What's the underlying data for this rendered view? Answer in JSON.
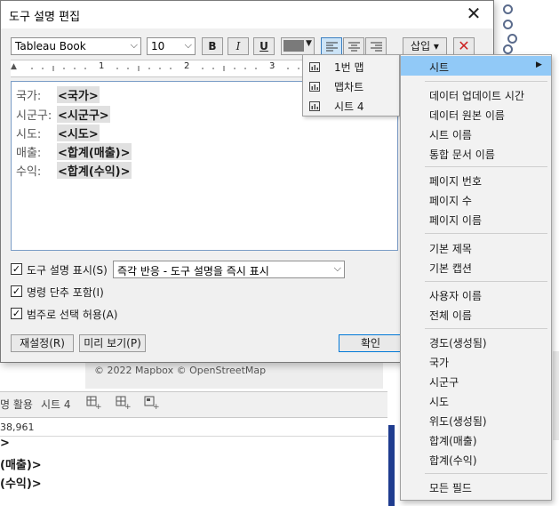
{
  "dialog": {
    "title": "도구 설명 편집",
    "font_name": "Tableau Book",
    "font_size": "10",
    "bold_label": "B",
    "italic_label": "I",
    "underline_label": "U",
    "insert_label": "삽입 ▾",
    "ruler_numbers": [
      "1",
      "2",
      "3"
    ],
    "lines": [
      {
        "label": "국가:",
        "field": "<국가>"
      },
      {
        "label": "시군구:",
        "field": "<시군구>"
      },
      {
        "label": "시도:",
        "field": "<시도>"
      },
      {
        "label": "매출:",
        "field": "<합계(매출)>"
      },
      {
        "label": "수익:",
        "field": "<합계(수익)>"
      }
    ],
    "options": {
      "show_tooltip": {
        "label": "도구 설명 표시(S)",
        "checked": true
      },
      "tooltip_mode": "즉각 반응 - 도구 설명을 즉시 표시",
      "include_brief": {
        "label": "명령 단추 포함(I)",
        "checked": true
      },
      "allow_category": {
        "label": "범주로 선택 허용(A)",
        "checked": true
      }
    },
    "buttons": {
      "reset": "재설정(R)",
      "preview": "미리 보기(P)",
      "ok": "확인"
    }
  },
  "sheet_menu": {
    "items": [
      "1번 맵",
      "맵차트",
      "시트 4"
    ]
  },
  "insert_menu": {
    "header": "시트",
    "groups": [
      [
        "데이터 업데이트 시간",
        "데이터 원본 이름",
        "시트 이름",
        "통합 문서 이름"
      ],
      [
        "페이지 번호",
        "페이지 수",
        "페이지 이름"
      ],
      [
        "기본 제목",
        "기본 캡션"
      ],
      [
        "사용자 이름",
        "전체 이름"
      ],
      [
        "경도(생성됨)",
        "국가",
        "시군구",
        "시도",
        "위도(생성됨)",
        "합계(매출)",
        "합계(수익)"
      ],
      [
        "모든 필드"
      ]
    ]
  },
  "background": {
    "map_credit": "© 2022 Mapbox © OpenStreetMap",
    "tab_active": "명 활용",
    "tab_sheet4": "시트 4",
    "status_text": "38,961",
    "line_1": ">",
    "line_2": "(매출)>",
    "line_3": "(수익)>"
  },
  "colors": {
    "accent": "#0078d7",
    "menu_highlight": "#91c9f7",
    "clear_icon": "#cc2222",
    "font_color_swatch": "#7a7a7a"
  }
}
